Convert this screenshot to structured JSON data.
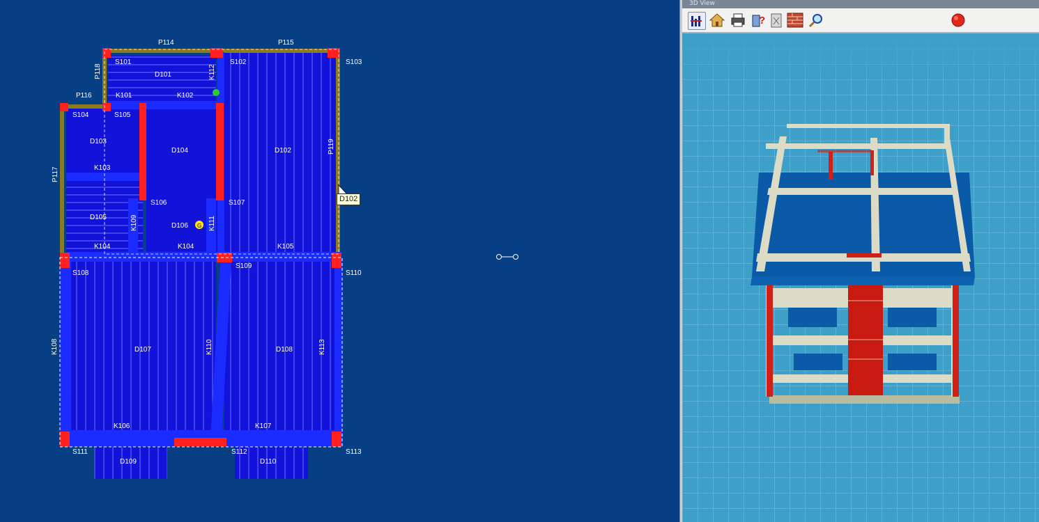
{
  "plan": {
    "beams": [
      "P114",
      "P115",
      "P118",
      "P116",
      "P117",
      "P119",
      "K101",
      "K102",
      "K103",
      "K104",
      "K105",
      "K106",
      "K107",
      "K108",
      "K109",
      "K110",
      "K111",
      "K112",
      "K113"
    ],
    "columns": [
      "S101",
      "S102",
      "S103",
      "S104",
      "S105",
      "S106",
      "S107",
      "S108",
      "S109",
      "S110",
      "S111",
      "S112",
      "S113"
    ],
    "slabs": [
      "D101",
      "D102",
      "D103",
      "D104",
      "D105",
      "D106",
      "D107",
      "D108",
      "D109",
      "D110"
    ],
    "tooltip": "D102"
  },
  "view3d": {
    "title": "3D View"
  },
  "colors": {
    "background": "#073f85",
    "slab": "#1212d8",
    "beam": "#1a2cff",
    "column": "#ff2020",
    "wall": "#8c7a20",
    "grid_bg": "#3e9fc8"
  },
  "toolbar": {
    "icons": [
      "plan-view-icon",
      "home-icon",
      "printer-icon",
      "help-icon",
      "checkbox-icon",
      "brick-wall-icon",
      "zoom-icon",
      "close-icon"
    ]
  }
}
